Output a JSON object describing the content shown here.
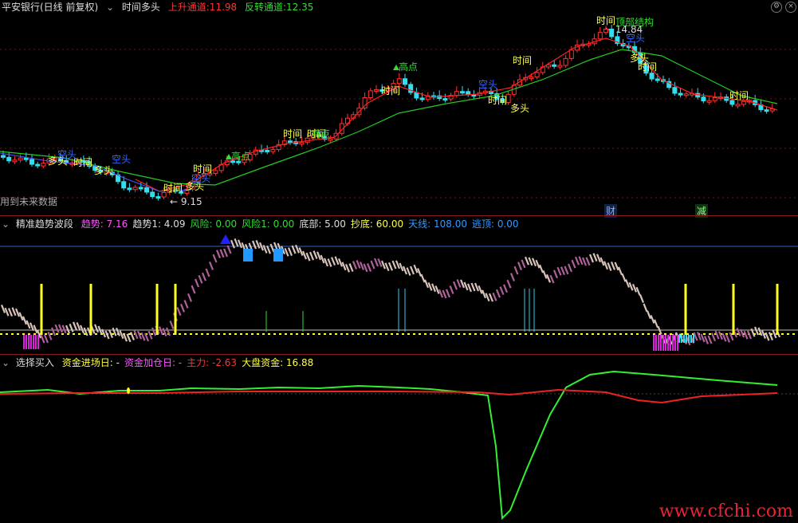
{
  "main": {
    "title": "平安银行(日线 前复权)",
    "indicator": "时间多头",
    "up_channel_label": "上升通道:",
    "up_channel_value": "11.98",
    "rev_channel_label": "反转通道:",
    "rev_channel_value": "12.35",
    "future_note": "用到未来数据",
    "low_label": "← 9.15",
    "high_label": "← 14.84",
    "tags": {
      "time": "时间",
      "long": "多头",
      "short": "空头",
      "high": "高点",
      "top": "顶部结构",
      "cai": "财",
      "jian": "减"
    }
  },
  "pane2": {
    "title": "精准趋势波段",
    "items": [
      {
        "label": "趋势:",
        "value": "7.16",
        "color": "#ff55ff"
      },
      {
        "label": "趋势1:",
        "value": "4.09",
        "color": "#dddddd"
      },
      {
        "label": "风险:",
        "value": "0.00",
        "color": "#33dd33"
      },
      {
        "label": "风险1:",
        "value": "0.00",
        "color": "#33dd33"
      },
      {
        "label": "底部:",
        "value": "5.00",
        "color": "#dddddd"
      },
      {
        "label": "抄底:",
        "value": "60.00",
        "color": "#ffff44"
      },
      {
        "label": "天线:",
        "value": "108.00",
        "color": "#3399ff"
      },
      {
        "label": "逃顶:",
        "value": "0.00",
        "color": "#3399ff"
      }
    ]
  },
  "pane3": {
    "title": "选择买入",
    "items": [
      {
        "label": "资金进场日:",
        "value": "-",
        "color": "#ffff44"
      },
      {
        "label": "资金加仓日:",
        "value": "-",
        "color": "#ff55ff"
      },
      {
        "label": "主力:",
        "value": "-2.63",
        "color": "#ff3333"
      },
      {
        "label": "大盘资金:",
        "value": "16.88",
        "color": "#ffff44"
      }
    ]
  },
  "watermark": "www.cfchi.com",
  "colors": {
    "up": "#ff3333",
    "down": "#33ddee",
    "ma": "#22cc22",
    "ma2": "#ff2222",
    "pink": "#b0609a",
    "beige": "#d8c4b8",
    "yellow": "#ffff22",
    "blue": "#2299ff"
  }
}
